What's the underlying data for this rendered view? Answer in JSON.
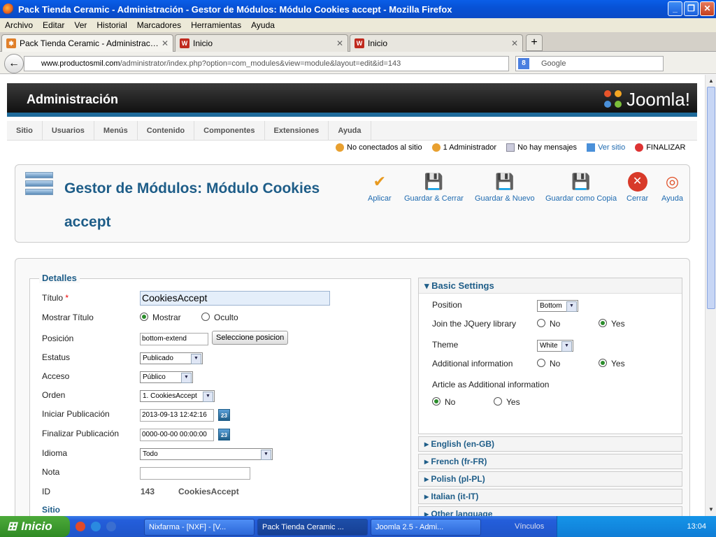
{
  "window": {
    "title": "Pack Tienda Ceramic - Administración - Gestor de Módulos: Módulo Cookies accept - Mozilla Firefox"
  },
  "menubar": [
    "Archivo",
    "Editar",
    "Ver",
    "Historial",
    "Marcadores",
    "Herramientas",
    "Ayuda"
  ],
  "tabs": [
    {
      "label": "Pack Tienda Ceramic - Administración - G...",
      "active": true
    },
    {
      "label": "Inicio",
      "active": false
    },
    {
      "label": "Inicio",
      "active": false
    }
  ],
  "nav": {
    "url_host": "www.productosmil.com",
    "url_path": "/administrator/index.php?option=com_modules&view=module&layout=edit&id=143",
    "search_placeholder": "Google"
  },
  "joomla": {
    "header_title": "Administración",
    "logo": "Joomla!",
    "menu": [
      "Sitio",
      "Usuarios",
      "Menús",
      "Contenido",
      "Componentes",
      "Extensiones",
      "Ayuda"
    ],
    "status": {
      "offline": "No conectados al sitio",
      "admins": "1 Administrador",
      "messages": "No hay mensajes",
      "view_site": "Ver sitio",
      "logout": "FINALIZAR"
    },
    "page_title": "Gestor de Módulos: Módulo Cookies accept",
    "toolbar": {
      "apply": "Aplicar",
      "save_close": "Guardar & Cerrar",
      "save_new": "Guardar & Nuevo",
      "save_copy": "Guardar como Copia",
      "close": "Cerrar",
      "help": "Ayuda"
    }
  },
  "details": {
    "legend": "Detalles",
    "title_label": "Título",
    "title_value": "CookiesAccept",
    "show_title_label": "Mostrar Título",
    "show_title_on": "Mostrar",
    "show_title_off": "Oculto",
    "position_label": "Posición",
    "position_value": "bottom-extend",
    "position_button": "Seleccione posicion",
    "status_label": "Estatus",
    "status_value": "Publicado",
    "access_label": "Acceso",
    "access_value": "Público",
    "order_label": "Orden",
    "order_value": "1. CookiesAccept",
    "start_label": "Iniciar Publicación",
    "start_value": "2013-09-13 12:42:16",
    "end_label": "Finalizar Publicación",
    "end_value": "0000-00-00 00:00:00",
    "language_label": "Idioma",
    "language_value": "Todo",
    "note_label": "Nota",
    "note_value": "",
    "id_label": "ID",
    "id_value": "143",
    "id_name": "CookiesAccept",
    "site_label": "Sitio"
  },
  "basic": {
    "header": "Basic Settings",
    "position_label": "Position",
    "position_value": "Bottom",
    "jquery_label": "Join the JQuery library",
    "theme_label": "Theme",
    "theme_value": "White",
    "addinfo_label": "Additional information",
    "article_label": "Article as Additional information",
    "no": "No",
    "yes": "Yes"
  },
  "languages": [
    "English (en-GB)",
    "French (fr-FR)",
    "Polish (pl-PL)",
    "Italian (it-IT)",
    "Other language"
  ],
  "taskbar": {
    "start": "Inicio",
    "tasks": [
      "Nixfarma - [NXF] - [V...",
      "Pack Tienda Ceramic ...",
      "Joomla 2.5 - Admi..."
    ],
    "vinculos": "Vínculos",
    "clock": "13:04"
  }
}
